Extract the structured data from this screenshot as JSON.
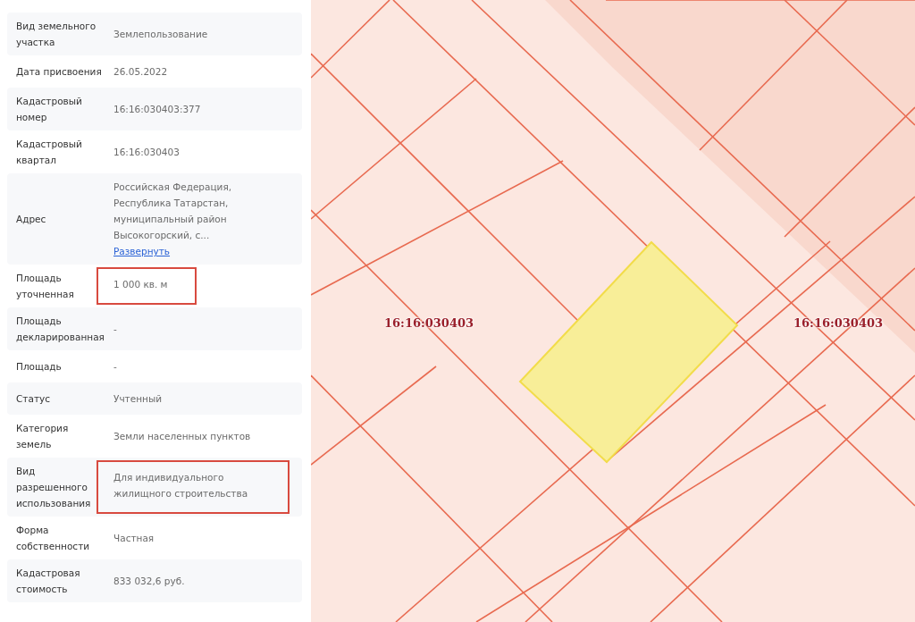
{
  "properties": [
    {
      "label": "Вид земельного участка",
      "value": "Землепользование",
      "highlighted": false
    },
    {
      "label": "Дата присвоения",
      "value": "26.05.2022",
      "highlighted": false
    },
    {
      "label": "Кадастровый номер",
      "value": "16:16:030403:377",
      "highlighted": false
    },
    {
      "label": "Кадастровый квартал",
      "value": "16:16:030403",
      "highlighted": false
    },
    {
      "label": "Адрес",
      "value": "Российская Федерация, Республика Татарстан, муниципальный район Высокогорский, с...",
      "link": "Развернуть",
      "highlighted": false
    },
    {
      "label": "Площадь уточненная",
      "value": "1 000 кв. м",
      "highlighted": true
    },
    {
      "label": "Площадь декларированная",
      "value": "-",
      "highlighted": false
    },
    {
      "label": "Площадь",
      "value": "-",
      "highlighted": false
    },
    {
      "label": "Статус",
      "value": "Учтенный",
      "highlighted": false
    },
    {
      "label": "Категория земель",
      "value": "Земли населенных пунктов",
      "highlighted": false
    },
    {
      "label": "Вид разрешенного использования",
      "value": "Для индивидуального жилищного строительства",
      "highlighted": true
    },
    {
      "label": "Форма собственности",
      "value": "Частная",
      "highlighted": false
    },
    {
      "label": "Кадастровая стоимость",
      "value": "833 032,6 руб.",
      "highlighted": false
    }
  ],
  "map": {
    "quarter_labels": [
      "16:16:030403",
      "16:16:030403"
    ]
  }
}
